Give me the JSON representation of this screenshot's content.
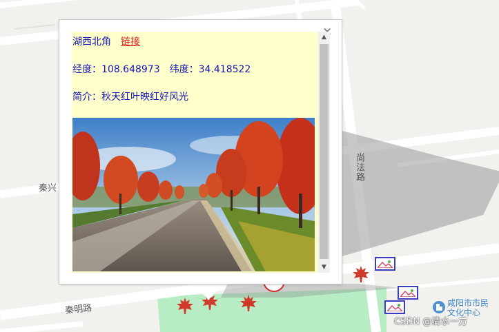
{
  "map": {
    "road_labels": {
      "qinxing": "秦兴",
      "qinming": "秦明路",
      "shangfa": "尚法路"
    },
    "poi": {
      "label_line1": "咸阳市市民",
      "label_line2": "文化中心",
      "icon": "building-icon"
    },
    "watermark": "CSDN @清水一方",
    "markers": {
      "leaf_icon": "maple-leaf-icon",
      "photo_icon": "photo-icon",
      "leaf_color": "#d03a2a"
    },
    "colors": {
      "background": "#f2f1ee",
      "road": "#ffffff",
      "park": "#b7ecc4",
      "marker_border": "#3b3bc0"
    }
  },
  "popup": {
    "close_label": "×",
    "title": "湖西北角",
    "link_text": "链接",
    "lon_label": "经度：",
    "lon_value": "108.648973",
    "lat_label": "纬度：",
    "lat_value": "34.418522",
    "intro_label": "简介：",
    "intro_text": "秋天红叶映红好风光",
    "content_bg": "#ffffcc",
    "text_color": "#1515b8",
    "link_color": "#e02020",
    "photo_alt": "autumn-red-trees-path-photo"
  }
}
